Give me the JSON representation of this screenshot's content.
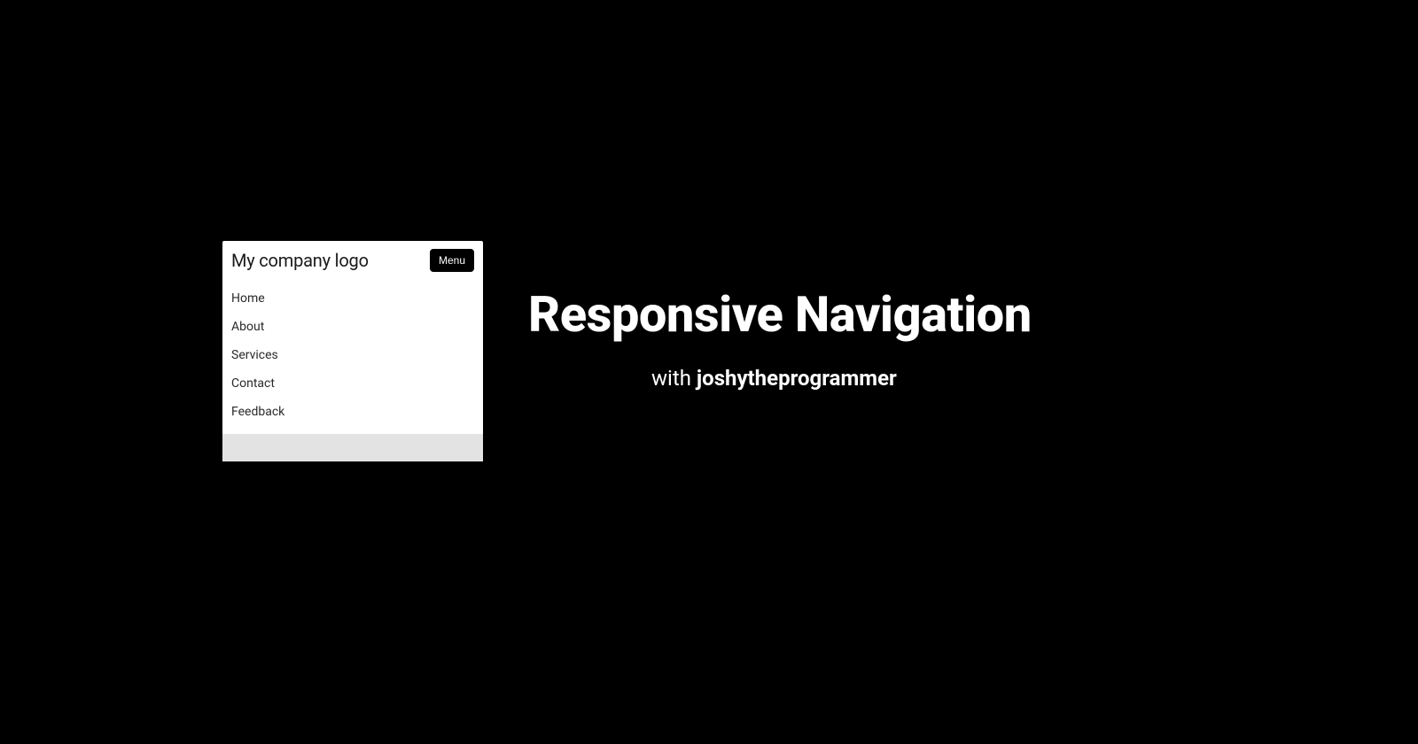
{
  "card": {
    "logo": "My company logo",
    "menu_button": "Menu",
    "nav": [
      "Home",
      "About",
      "Services",
      "Contact",
      "Feedback"
    ]
  },
  "headline": "Responsive Navigation",
  "subline": {
    "prefix": "with ",
    "author": "joshytheprogrammer"
  }
}
